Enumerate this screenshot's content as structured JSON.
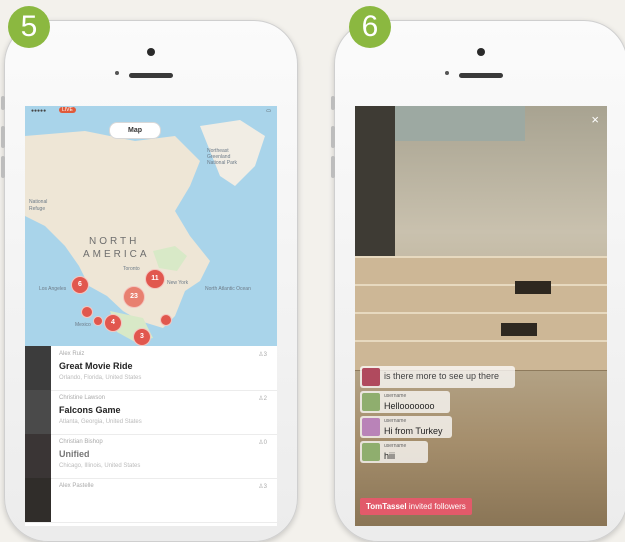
{
  "steps": {
    "left": "5",
    "right": "6"
  },
  "map_screen": {
    "status": {
      "live": "LIVE"
    },
    "tab_label": "Map",
    "region_labels": {
      "north": "NORTH",
      "america": "AMERICA",
      "northeast": "Northeast Greenland National Park",
      "wildlife": "Refuge",
      "national": "National",
      "ocean": "North Atlantic Ocean",
      "toronto": "Toronto",
      "new_york": "New York",
      "los_angeles": "Los Angeles",
      "mexico": "Mexico"
    },
    "clusters": [
      {
        "label": "6"
      },
      {
        "label": "11"
      },
      {
        "label": "23"
      },
      {
        "label": "4"
      },
      {
        "label": "3"
      },
      {
        "label": ""
      },
      {
        "label": ""
      },
      {
        "label": ""
      }
    ],
    "streams": [
      {
        "user": "Alex Ruiz",
        "title": "Great Movie Ride",
        "location": "Orlando, Florida, United States",
        "count": "3"
      },
      {
        "user": "Christine Lawson",
        "title": "Falcons Game",
        "location": "Atlanta, Georgia, United States",
        "count": "2"
      },
      {
        "user": "Christian Bishop",
        "title": "Unified",
        "location": "Chicago, Illinois, United States",
        "count": "0"
      },
      {
        "user": "Alex Pastelle",
        "title": "",
        "location": "",
        "count": "3"
      }
    ]
  },
  "stream_screen": {
    "close_symbol": "×",
    "chats": [
      {
        "user": "",
        "message": "is there more to see up there",
        "avatar_color": "#b04a5e"
      },
      {
        "user": "username",
        "message": "Hellooooooo",
        "avatar_color": "#8fae6e"
      },
      {
        "user": "username",
        "message": "Hi from Turkey",
        "avatar_color": "#b983b8"
      },
      {
        "user": "username",
        "message": "hiii",
        "avatar_color": "#8fae6e"
      }
    ],
    "invite": {
      "user": "TomTassel",
      "text": "invited followers"
    }
  },
  "colors": {
    "badge": "#8bb840",
    "cluster": "#e1574e",
    "invite": "#e25a6a",
    "live": "#e05a3a"
  }
}
